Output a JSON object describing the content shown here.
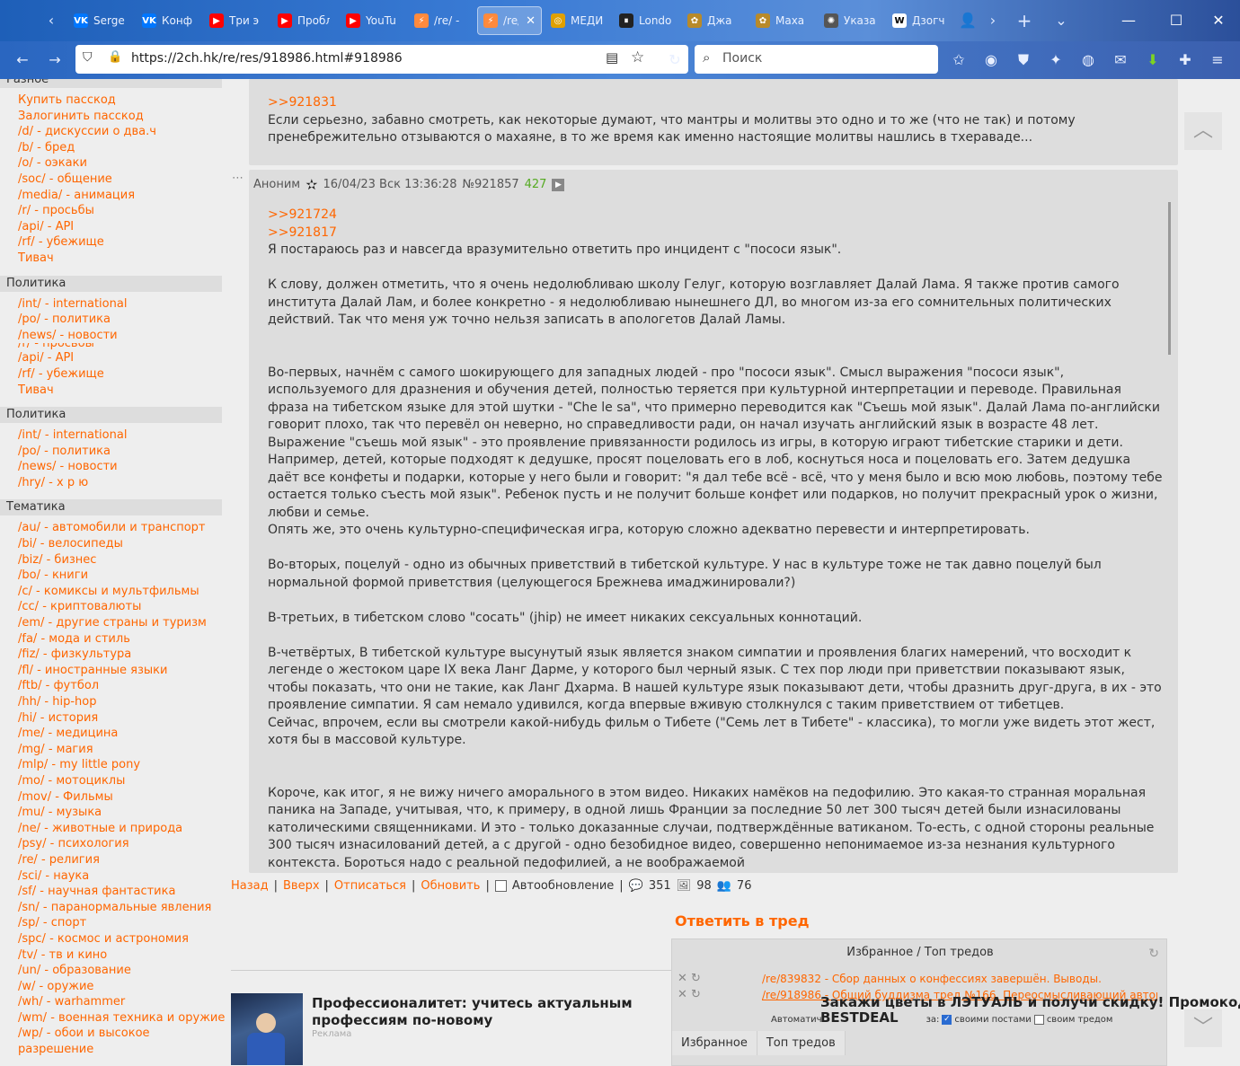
{
  "browser": {
    "tabs": [
      {
        "label": "Serge",
        "icon": "vk-icon",
        "color": "#0077ff",
        "glyph": "VK"
      },
      {
        "label": "Конф",
        "icon": "vk-icon",
        "color": "#0077ff",
        "glyph": "VK"
      },
      {
        "label": "Три э",
        "icon": "youtube-icon",
        "color": "#ff0000",
        "glyph": "▶"
      },
      {
        "label": "Пробл",
        "icon": "youtube-icon",
        "color": "#ff0000",
        "glyph": "▶"
      },
      {
        "label": "YouTu",
        "icon": "youtube-icon",
        "color": "#ff0000",
        "glyph": "▶"
      },
      {
        "label": "/re/ -",
        "icon": "lightning-icon",
        "color": "#ff8a3d",
        "glyph": "⚡"
      },
      {
        "label": "/re/",
        "icon": "lightning-icon",
        "color": "#ff8a3d",
        "glyph": "⚡",
        "active": true
      },
      {
        "label": "МЕДИ",
        "icon": "medi-icon",
        "color": "#e0a000",
        "glyph": "◎"
      },
      {
        "label": "Londo",
        "icon": "pause-icon",
        "color": "#222222",
        "glyph": "⏸"
      },
      {
        "label": "Джа",
        "icon": "emblem-icon",
        "color": "#b88a2a",
        "glyph": "✿"
      },
      {
        "label": "Маха",
        "icon": "emblem-icon",
        "color": "#b88a2a",
        "glyph": "✿"
      },
      {
        "label": "Указа",
        "icon": "emblem-icon",
        "color": "#555555",
        "glyph": "✺"
      },
      {
        "label": "Дзогч",
        "icon": "wikipedia-icon",
        "color": "#ffffff",
        "glyph": "W"
      }
    ],
    "url": "https://2ch.hk/re/res/918986.html#918986",
    "search_placeholder": "Поиск"
  },
  "sidebar": {
    "sections": [
      {
        "title": "Разное",
        "items": [
          {
            "code": "",
            "label": "Купить пасскод"
          },
          {
            "code": "",
            "label": "Залогинить пасскод"
          },
          {
            "code": "/d/",
            "label": "дискуссии о два.ч"
          },
          {
            "code": "/b/",
            "label": "бред"
          },
          {
            "code": "/o/",
            "label": "оэкаки"
          },
          {
            "code": "/soc/",
            "label": "общение"
          },
          {
            "code": "/media/",
            "label": "анимация"
          },
          {
            "code": "/r/",
            "label": "просьбы"
          },
          {
            "code": "/api/",
            "label": "API"
          },
          {
            "code": "/rf/",
            "label": "убежище"
          },
          {
            "code": "",
            "label": "Тивач"
          }
        ]
      },
      {
        "title": "Политика",
        "items": [
          {
            "code": "/int/",
            "label": "international"
          },
          {
            "code": "/po/",
            "label": "политика"
          },
          {
            "code": "/news/",
            "label": "новости"
          },
          {
            "code": "/r/",
            "label": "просьбы"
          },
          {
            "code": "/api/",
            "label": "API"
          },
          {
            "code": "/rf/",
            "label": "убежище"
          },
          {
            "code": "",
            "label": "Тивач"
          }
        ]
      },
      {
        "title": "Политика",
        "items": [
          {
            "code": "/int/",
            "label": "international"
          },
          {
            "code": "/po/",
            "label": "политика"
          },
          {
            "code": "/news/",
            "label": "новости"
          },
          {
            "code": "/hry/",
            "label": "х р ю"
          }
        ]
      },
      {
        "title": "Тематика",
        "items": [
          {
            "code": "/au/",
            "label": "автомобили и транспорт"
          },
          {
            "code": "/bi/",
            "label": "велосипеды"
          },
          {
            "code": "/biz/",
            "label": "бизнес"
          },
          {
            "code": "/bo/",
            "label": "книги"
          },
          {
            "code": "/c/",
            "label": "комиксы и мультфильмы"
          },
          {
            "code": "/cc/",
            "label": "криптовалюты"
          },
          {
            "code": "/em/",
            "label": "другие страны и туризм"
          },
          {
            "code": "/fa/",
            "label": "мода и стиль"
          },
          {
            "code": "/fiz/",
            "label": "физкультура"
          },
          {
            "code": "/fl/",
            "label": "иностранные языки"
          },
          {
            "code": "/ftb/",
            "label": "футбол"
          },
          {
            "code": "/hh/",
            "label": "hip-hop"
          },
          {
            "code": "/hi/",
            "label": "история"
          },
          {
            "code": "/me/",
            "label": "медицина"
          },
          {
            "code": "/mg/",
            "label": "магия"
          },
          {
            "code": "/mlp/",
            "label": "my little pony"
          },
          {
            "code": "/mo/",
            "label": "мотоциклы"
          },
          {
            "code": "/mov/",
            "label": "Фильмы"
          },
          {
            "code": "/mu/",
            "label": "музыка"
          },
          {
            "code": "/ne/",
            "label": "животные и природа"
          },
          {
            "code": "/psy/",
            "label": "психология"
          },
          {
            "code": "/re/",
            "label": "религия"
          },
          {
            "code": "/sci/",
            "label": "наука"
          },
          {
            "code": "/sf/",
            "label": "научная фантастика"
          },
          {
            "code": "/sn/",
            "label": "паранормальные явления"
          },
          {
            "code": "/sp/",
            "label": "спорт"
          },
          {
            "code": "/spc/",
            "label": "космос и астрономия"
          },
          {
            "code": "/tv/",
            "label": "тв и кино"
          },
          {
            "code": "/un/",
            "label": "образование"
          },
          {
            "code": "/w/",
            "label": "оружие"
          },
          {
            "code": "/wh/",
            "label": "warhammer"
          },
          {
            "code": "/wm/",
            "label": "военная техника и оружие"
          },
          {
            "code": "/wp/",
            "label": "обои и высокое"
          },
          {
            "code": "",
            "label": "разрешение"
          }
        ]
      }
    ]
  },
  "post1": {
    "reflink": ">>921831",
    "text": "Если серьезно, забавно смотреть, как некоторые думают, что мантры и молитвы это одно и то же (что не так) и потому пренебрежительно отзываются о махаяне, в то же время как именно настоящие молитвы нашлись в тхераваде..."
  },
  "post2": {
    "author": "Аноним",
    "date": "16/04/23 Вск 13:36:28",
    "number": "№921857",
    "reply_count": "427",
    "reflinks": [
      ">>921724",
      ">>921817"
    ],
    "paragraphs": [
      "Я постараюсь раз и навсегда вразумительно ответить про инцидент с \"пососи язык\".",
      "",
      "К слову, должен отметить, что я очень недолюбливаю школу Гелуг, которую возглавляет Далай Лама. Я также против самого института Далай Лам, и более конкретно - я недолюбливаю нынешнего ДЛ, во многом из-за его сомнительных политических действий. Так что меня уж точно нельзя записать в апологетов Далай Ламы.",
      "",
      "",
      "Во-первых, начнём с самого шокирующего для западных людей - про \"пососи язык\". Смысл выражения \"пососи язык\", используемого для дразнения и обучения детей, полностью теряется при культурной интерпретации и переводе. Правильная фраза на тибетском языке для этой шутки - \"Che le sa\", что примерно переводится как \"Съешь мой язык\". Далай Лама по-английски говорит плохо, так что перевёл он неверно, но справедливости ради, он начал изучать английский язык в возрасте 48 лет.",
      "Выражение \"съешь мой язык\" - это проявление привязанности родилось из игры, в которую играют тибетские старики и дети. Например, детей, которые подходят к дедушке, просят поцеловать его в лоб, коснуться носа и поцеловать его. Затем дедушка даёт все конфеты и подарки, которые у него были и говорит: \"я дал тебе всё - всё, что у меня было и всю мою любовь, поэтому тебе остается только съесть мой язык\". Ребенок пусть и не получит больше конфет или подарков, но получит прекрасный урок о жизни, любви и семье.",
      "Опять же, это очень культурно-специфическая игра, которую сложно адекватно перевести и интерпретировать.",
      "",
      "Во-вторых, поцелуй - одно из обычных приветствий в тибетской культуре. У нас в культуре тоже не так давно поцелуй был нормальной формой приветствия (целующегося Брежнева имаджинировали?)",
      "",
      "В-третьих, в тибетском слово \"сосать\" (jhip) не имеет никаких сексуальных коннотаций.",
      "",
      "В-четвёртых, В тибетской культуре высунутый язык является знаком симпатии и проявления благих намерений, что восходит к легенде о жестоком царе IX века Ланг Дарме, у которого был черный язык. С тех пор люди при приветствии показывают язык, чтобы показать, что они не такие, как Ланг Дхарма. В нашей культуре язык показывают дети, чтобы дразнить друг-друга, в их - это проявление симпатии. Я сам немало удивился, когда впервые вживую столкнулся с таким приветствием от тибетцев.",
      "Сейчас, впрочем, если вы смотрели какой-нибудь фильм о Тибете (\"Семь лет в Тибете\" - классика), то могли уже видеть этот жест, хотя бы в массовой культуре.",
      "",
      "",
      "Короче, как итог, я не вижу ничего аморального в этом видео. Никаких намёков на педофилию. Это какая-то странная моральная паника на Западе, учитывая, что, к примеру, в одной лишь Франции за последние 50 лет 300 тысяч детей были изнасилованы католическими священниками. И это - только доказанные случаи, подтверждённые ватиканом. То-есть, с одной стороны реальные 300 тысяч изнасилований детей, а с другой - одно безобидное видео, совершенно непонимаемое из-за незнания культурного контекста. Бороться надо с реальной педофилией, а не воображаемой"
    ]
  },
  "thread_nav": {
    "back": "Назад",
    "up": "Вверх",
    "unsubscribe": "Отписаться",
    "refresh": "Обновить",
    "autoupdate": "Автообновление",
    "posts_count": "351",
    "images_count": "98",
    "users_count": "76"
  },
  "reply_title": "Ответить в тред",
  "favorites": {
    "title": "Избранное / Топ тредов",
    "rows": [
      "/re/839832 - Сбор данных о конфессиях завершён. Выводы.",
      "/re/918986 - Общий буддизма тред №166. Переосмысливающий автори..."
    ],
    "auto_prefix": "Автоматич",
    "auto_mid": "за:",
    "own_posts": "своими постами",
    "own_thread": "своим тредом",
    "tab_fav": "Избранное",
    "tab_top": "Топ тредов"
  },
  "promo": {
    "line1": "Закажи цветы в ЛЭТУАЛЬ и получи скидку! Промокод",
    "line2": "BESTDEAL"
  },
  "ad": {
    "title": "Профессионалитет: учитесь актуальным профессиям по-новому",
    "label": "Реклама"
  }
}
